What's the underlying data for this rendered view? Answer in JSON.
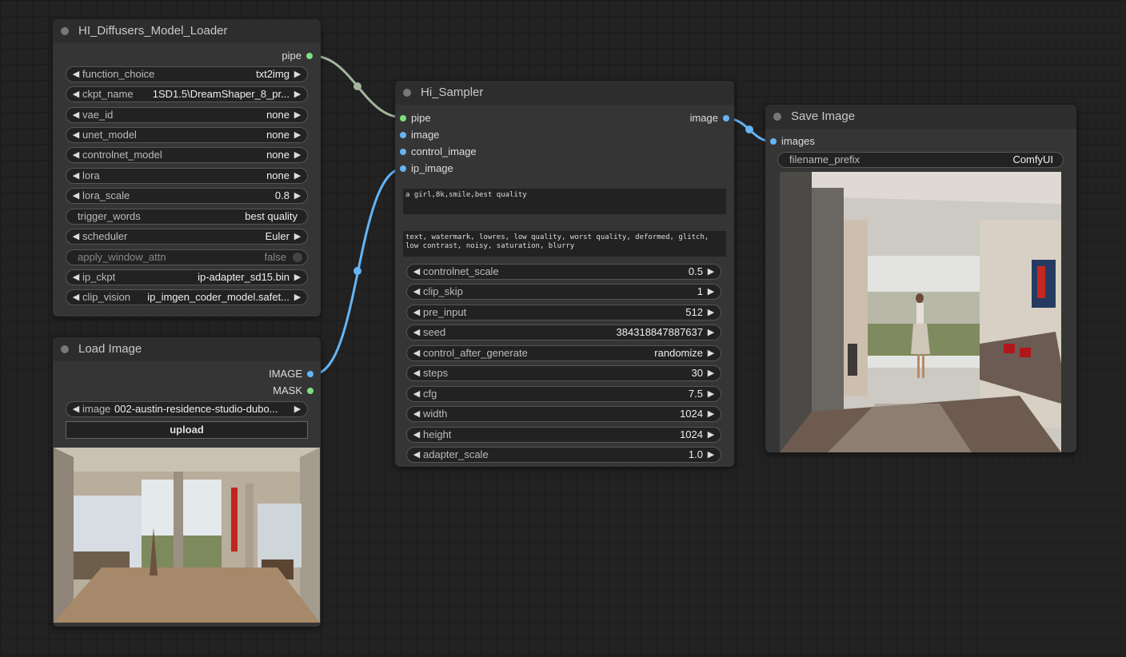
{
  "loader": {
    "title": "HI_Diffusers_Model_Loader",
    "output_pipe": "pipe",
    "widgets": [
      {
        "label": "function_choice",
        "value": "txt2img",
        "arrows": true
      },
      {
        "label": "ckpt_name",
        "value": "1SD1.5\\DreamShaper_8_pr...",
        "arrows": true
      },
      {
        "label": "vae_id",
        "value": "none",
        "arrows": true
      },
      {
        "label": "unet_model",
        "value": "none",
        "arrows": true
      },
      {
        "label": "controlnet_model",
        "value": "none",
        "arrows": true
      },
      {
        "label": "lora",
        "value": "none",
        "arrows": true
      },
      {
        "label": "lora_scale",
        "value": "0.8",
        "arrows": true
      },
      {
        "label": "trigger_words",
        "value": "best quality",
        "arrows": false
      },
      {
        "label": "scheduler",
        "value": "Euler",
        "arrows": true
      },
      {
        "label": "apply_window_attn",
        "value": "false",
        "arrows": false
      },
      {
        "label": "ip_ckpt",
        "value": "ip-adapter_sd15.bin",
        "arrows": true
      },
      {
        "label": "clip_vision",
        "value": "ip_imgen_coder_model.safet...",
        "arrows": true
      }
    ]
  },
  "load_image": {
    "title": "Load Image",
    "outputs": [
      "IMAGE",
      "MASK"
    ],
    "image_label": "image",
    "image_value": "002-austin-residence-studio-dubo...",
    "upload_label": "upload"
  },
  "sampler": {
    "title": "Hi_Sampler",
    "inputs": [
      "pipe",
      "image",
      "control_image",
      "ip_image"
    ],
    "output": "image",
    "positive_prompt": "a girl,8k,smile,best quality",
    "negative_prompt": "text, watermark, lowres, low quality, worst quality, deformed, glitch, low contrast, noisy, saturation, blurry",
    "widgets": [
      {
        "label": "controlnet_scale",
        "value": "0.5"
      },
      {
        "label": "clip_skip",
        "value": "1"
      },
      {
        "label": "pre_input",
        "value": "512"
      },
      {
        "label": "seed",
        "value": "384318847887637"
      },
      {
        "label": "control_after_generate",
        "value": "randomize"
      },
      {
        "label": "steps",
        "value": "30"
      },
      {
        "label": "cfg",
        "value": "7.5"
      },
      {
        "label": "width",
        "value": "1024"
      },
      {
        "label": "height",
        "value": "1024"
      },
      {
        "label": "adapter_scale",
        "value": "1.0"
      }
    ]
  },
  "save_image": {
    "title": "Save Image",
    "input": "images",
    "filename_label": "filename_prefix",
    "filename_value": "ComfyUI"
  },
  "colors": {
    "pipe_link": "#a3b59c",
    "image_link": "#64b5f6",
    "port_green": "#7ee07e",
    "port_blue": "#64b5f6"
  }
}
